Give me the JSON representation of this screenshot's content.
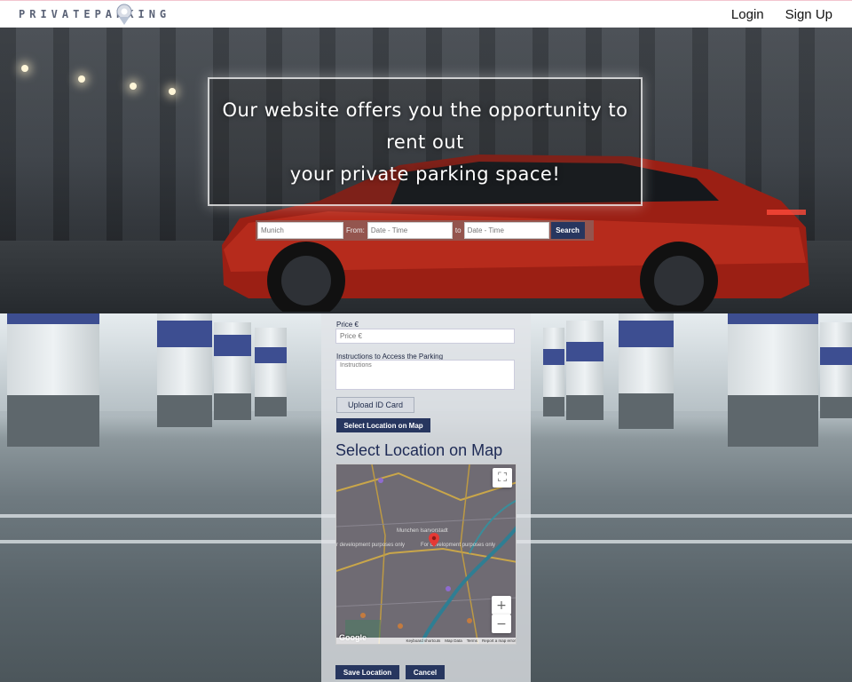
{
  "header": {
    "logo_text": "PRIVATEPARKING",
    "nav": {
      "login": "Login",
      "signup": "Sign Up"
    }
  },
  "hero": {
    "title_line1": "Our website offers you the opportunity to rent out",
    "title_line2": "your private parking space!",
    "search": {
      "location_placeholder": "Munich",
      "from_label": "From:",
      "from_placeholder": "Date - Time",
      "to_label": "to",
      "to_placeholder": "Date - Time",
      "search_button": "Search"
    }
  },
  "form": {
    "price_label": "Price €",
    "price_placeholder": "Price €",
    "instructions_label": "Instructions to Access the Parking",
    "instructions_placeholder": "Instructions",
    "upload_button": "Upload ID Card",
    "select_location_button": "Select Location on Map",
    "map_heading": "Select Location on Map",
    "save_button": "Save Location",
    "cancel_button": "Cancel"
  },
  "map": {
    "labels": {
      "dev_left": "r development purposes only",
      "dev_right": "For development purposes only",
      "city": "Munchen Isarvorstadt"
    },
    "zoom_in": "+",
    "zoom_out": "−",
    "fullscreen": "⛶",
    "google": "Google",
    "footer": [
      "Keyboard shortcuts",
      "Map Data",
      "Terms",
      "Report a map error"
    ]
  },
  "colors": {
    "accent": "#27365f",
    "marker": "#e53935"
  }
}
